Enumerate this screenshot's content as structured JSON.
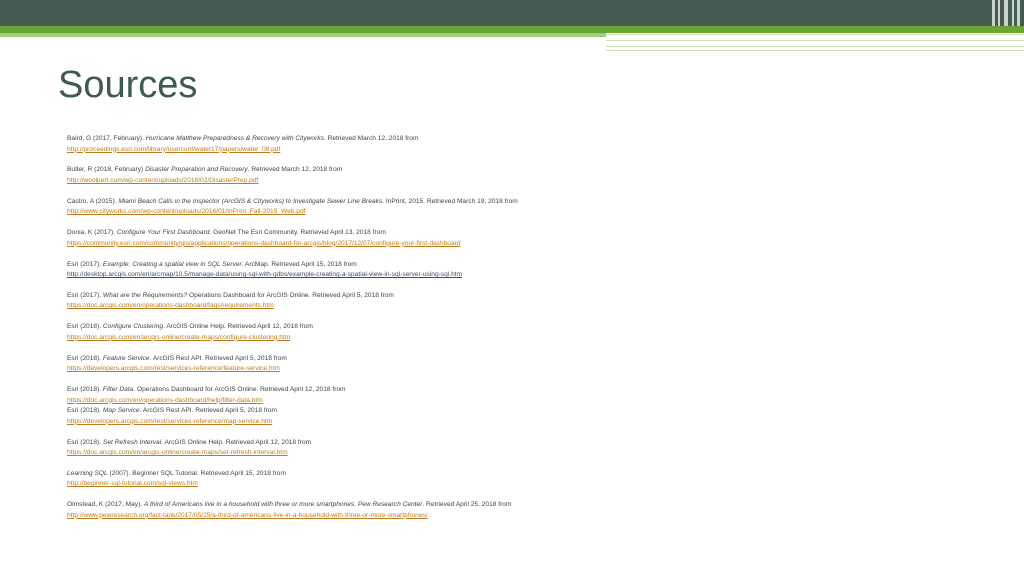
{
  "slide": {
    "title": "Sources"
  },
  "references": [
    {
      "pre": "Baird, G (2017, February).  ",
      "italic": "Hurricane Matthew Preparedness & Recovery with Cityworks",
      "post": ".  Retrieved March 12, 2018 from",
      "url": "http://proceedings.esri.com/library/userconf/water17/papers/water_08.pdf"
    },
    {
      "pre": "Butler, R (2018, February) ",
      "italic": "Disaster Preparation and Recovery",
      "post": ". Retrieved March 12, 2018 from",
      "url": "http://woolpert.com/wp-content/uploads/2018/02/DisasterPrep.pdf"
    },
    {
      "pre": "Castro, A (2015).  ",
      "italic": "Miami Beach Calls in the Inspector (ArcGIS & Cityworks) to Investigate Sewer Line Breaks",
      "post": ". InPrint, 2015. Retrieved March 19, 2018 from",
      "url": "http://www.cityworks.com/wp-content/uploads/2016/01/InPrint_Fall-2015_Web.pdf"
    },
    {
      "pre": "Donia, K (2017).  ",
      "italic": "Configure Your First Dashboard",
      "post": ".  GeoNet The Esri Community.  Retrieved April 13, 2018 from",
      "url": "https://community.esri.com/community/gis/applications/operations-dashboard-for-arcgis/blog/2017/12/07/configure-your-first-dashboard"
    },
    {
      "pre": "Esri (2017).  ",
      "italic": "Example: Creating a spatial view in SQL Server",
      "post": ". ArcMap.  Retrieved April 15, 2018 from",
      "url": "http://desktop.arcgis.com/en/arcmap/10.5/manage-data/using-sql-with-gdbs/example-creating-a-spatial-view-in-sql-server-using-sql.htm"
    },
    {
      "pre": "Esri (2017).  ",
      "italic": "What are the Requirements?",
      "post": "  Operations Dashboard for ArcGIS Online.  Retrieved April 5, 2018 from",
      "url": "https://doc.arcgis.com/en/operations-dashboard/faqs/requirements.htm"
    },
    {
      "pre": "Esri (2018).  ",
      "italic": "Configure Clustering",
      "post": ".  ArcGIS Online Help.  Retrieved April 12, 2018 from",
      "url": "https://doc.arcgis.com/en/arcgis-online/create-maps/configure-clustering.htm"
    },
    {
      "pre": "Esri (2018).  ",
      "italic": "Feature Service",
      "post": ". ArcGIS Rest API.  Retrieved April 5, 2018 from",
      "url": "https://developers.arcgis.com/rest/services-reference/feature-service.htm"
    },
    {
      "pre": "Esri (2018).  ",
      "italic": "Filter Data",
      "post": ".  Operations Dashboard for ArcGIS Online.  Retrieved April 12, 2018 from",
      "url": "https://doc.arcgis.com/en/operations-dashboard/help/filter-data.htm"
    },
    {
      "pre": "Esri (2018).  ",
      "italic": "Map Service",
      "post": ".  ArcGIS Rest API.  Retrieved April 5, 2018 from",
      "url": "https://developers.arcgis.com/rest/services-reference/map-service.htm"
    },
    {
      "pre": "Esri (2018).  ",
      "italic": "Set Refresh Interval",
      "post": ".  ArcGIS Online Help.  Retrieved April 12, 2018 from",
      "url": "https://doc.arcgis.com/en/arcgis-online/create-maps/set-refresh-interval.htm"
    },
    {
      "pre": "",
      "italic": "Learning SQL",
      "post": " (2007). Beginner SQL Tutorial. Retrieved April 15, 2018 from",
      "url": "http://beginner-sql-tutorial.com/sql-views.htm"
    },
    {
      "pre": "Olmstead, K (2017, May).  ",
      "italic": "A third of Americans live in a household with three or more smartphones.  Pew Research Center",
      "post": ".  Retrieved April 25, 2018 from",
      "url": "http://www.pewresearch.org/fact-tank/2017/05/25/a-third-of-americans-live-in-a-household-with-three-or-more-smartphones/"
    }
  ]
}
